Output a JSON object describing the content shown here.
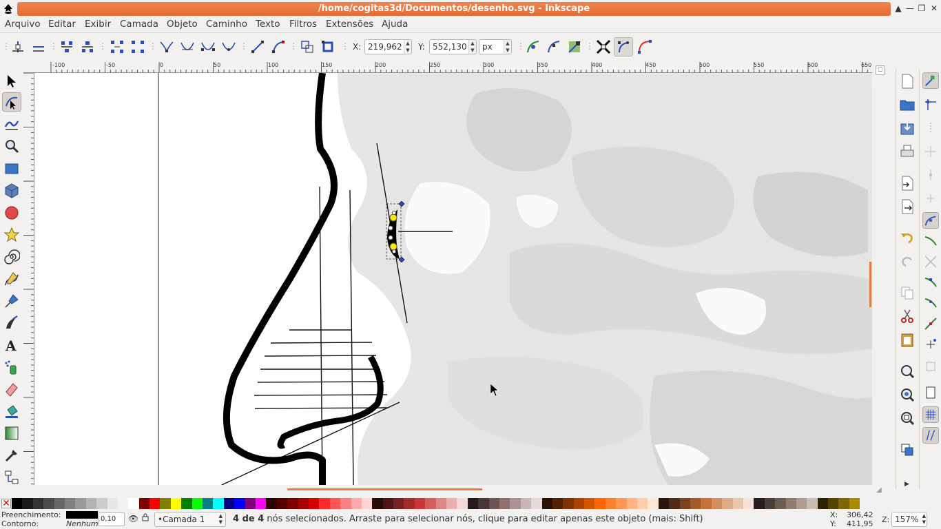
{
  "window": {
    "title": "/home/cogitas3d/Documentos/desenho.svg - Inkscape",
    "buttons": [
      "▲",
      "—",
      "❐",
      "✕"
    ]
  },
  "menu": [
    "Arquivo",
    "Editar",
    "Exibir",
    "Camada",
    "Objeto",
    "Caminho",
    "Texto",
    "Filtros",
    "Extensões",
    "Ajuda"
  ],
  "toolbar": {
    "x_label": "X:",
    "x_value": "219,962",
    "y_label": "Y:",
    "y_value": "552,130",
    "unit": "px"
  },
  "ruler": {
    "h_ticks": [
      "-100",
      "-50",
      "0",
      "50",
      "100",
      "150",
      "200",
      "250",
      "300",
      "350",
      "400",
      "450",
      "500",
      "550",
      "600",
      "650"
    ]
  },
  "status": {
    "fill_label": "Preenchimento:",
    "stroke_label": "Contorno:",
    "stroke_value": "Nenhum",
    "opacity_value": "0,10",
    "layer": "•Camada 1",
    "message_bold": "4 de 4",
    "message": " nós selecionados. Arraste para selecionar nós, clique para editar apenas este objeto (mais: Shift)",
    "cursor_x_label": "X:",
    "cursor_x": "306,42",
    "cursor_y_label": "Y:",
    "cursor_y": "411,95",
    "zoom_label": "Z:",
    "zoom": "157%"
  },
  "colors": {
    "accent": "#e97a44",
    "palette": [
      "#000000",
      "#1a1a1a",
      "#333333",
      "#4d4d4d",
      "#666666",
      "#808080",
      "#999999",
      "#b3b3b3",
      "#cccccc",
      "#e6e6e6",
      "#f2f2f2",
      "#ffffff",
      "#800000",
      "#ff0000",
      "#808000",
      "#ffff00",
      "#008000",
      "#00ff00",
      "#008080",
      "#00ffff",
      "#000080",
      "#0000ff",
      "#800080",
      "#ff00ff",
      "#2b0000",
      "#550000",
      "#800000",
      "#aa0000",
      "#d40000",
      "#ff2a2a",
      "#ff5555",
      "#ff8080",
      "#ffaaaa",
      "#ffd5d5",
      "#280b0b",
      "#501616",
      "#782121",
      "#a02c2c",
      "#c83737",
      "#d35f5f",
      "#de8787",
      "#e9afaf",
      "#f4d7d7",
      "#241c1c",
      "#483737",
      "#6c5353",
      "#916f6f",
      "#ac9393",
      "#c8b7b7",
      "#e3dbdb",
      "#2b1100",
      "#552200",
      "#803300",
      "#aa4400",
      "#d45500",
      "#ff6600",
      "#ff7f2a",
      "#ff9955",
      "#ffb380",
      "#ffccaa",
      "#ffe6d5",
      "#28170b",
      "#502d16",
      "#784421",
      "#a05a2c",
      "#c87137",
      "#d38d5f",
      "#deaa87",
      "#e9c6af",
      "#f4e3d7",
      "#241f1c",
      "#483e37",
      "#6c5d53",
      "#917c6f",
      "#ac9d93",
      "#c8beb7",
      "#2b2200",
      "#554400",
      "#806600",
      "#aa8800"
    ]
  }
}
